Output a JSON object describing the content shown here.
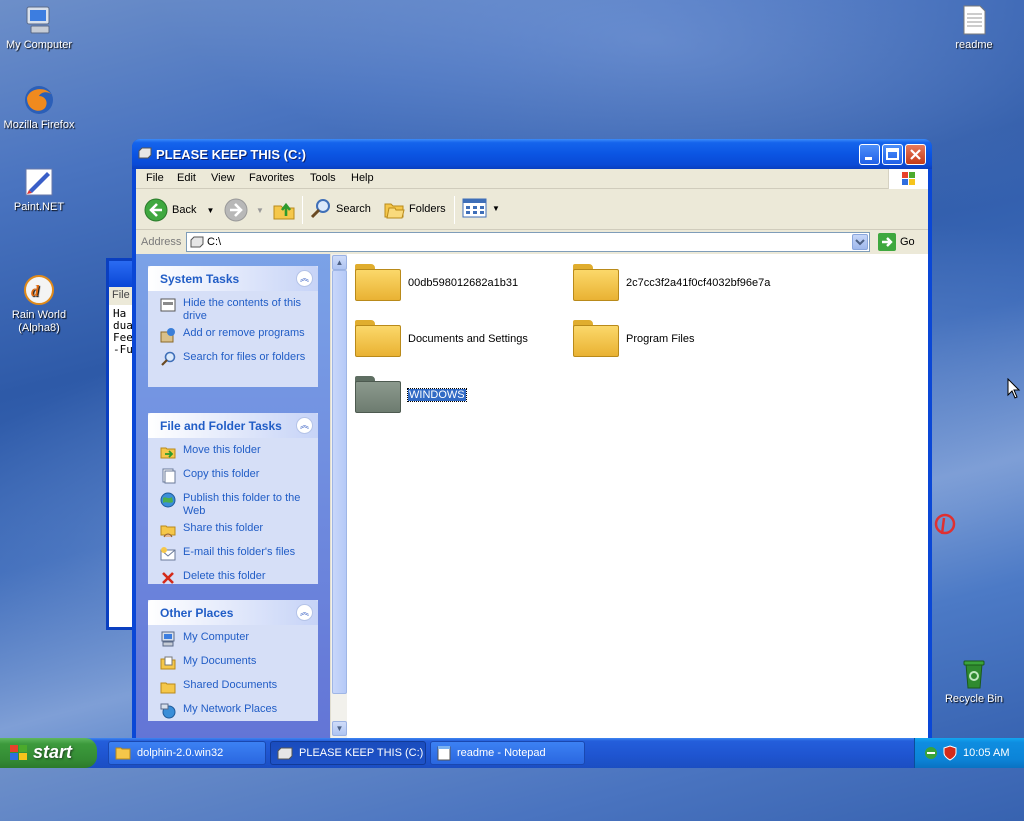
{
  "desktop": {
    "icons": [
      {
        "label": "My Computer"
      },
      {
        "label": "Mozilla Firefox"
      },
      {
        "label": "Paint.NET"
      },
      {
        "label": "Rain World\n(Alpha8)"
      },
      {
        "label": "readme"
      },
      {
        "label": "Recycle Bin"
      }
    ]
  },
  "background_window": {
    "menu_label": "File",
    "text_lines": [
      "Ha",
      "dua",
      "Fee",
      "-Fu"
    ]
  },
  "window": {
    "title": "PLEASE KEEP THIS (C:)",
    "menu": [
      "File",
      "Edit",
      "View",
      "Favorites",
      "Tools",
      "Help"
    ],
    "toolbar": {
      "back": "Back",
      "search": "Search",
      "folders": "Folders"
    },
    "address": {
      "label": "Address",
      "value": "C:\\",
      "go": "Go"
    },
    "task_pane": {
      "system_tasks": {
        "title": "System Tasks",
        "items": [
          "Hide the contents of this drive",
          "Add or remove programs",
          "Search for files or folders"
        ]
      },
      "file_folder_tasks": {
        "title": "File and Folder Tasks",
        "items": [
          "Move this folder",
          "Copy this folder",
          "Publish this folder to the Web",
          "Share this folder",
          "E-mail this folder's files",
          "Delete this folder"
        ]
      },
      "other_places": {
        "title": "Other Places",
        "items": [
          "My Computer",
          "My Documents",
          "Shared Documents",
          "My Network Places"
        ]
      }
    },
    "folders": [
      {
        "name": "00db598012682a1b31"
      },
      {
        "name": "2c7cc3f2a41f0cf4032bf96e7a"
      },
      {
        "name": "Documents and Settings"
      },
      {
        "name": "Program Files"
      },
      {
        "name": "WINDOWS",
        "selected": true
      }
    ]
  },
  "taskbar": {
    "start": "start",
    "tasks": [
      {
        "label": "dolphin-2.0.win32"
      },
      {
        "label": "PLEASE KEEP THIS (C:)",
        "active": true
      },
      {
        "label": "readme - Notepad"
      }
    ],
    "clock": "10:05 AM"
  },
  "colors": {
    "folder_yellow": "#f5c74a",
    "folder_gray": "#7b8a7f",
    "selection_blue": "#316ac5",
    "task_link": "#215dc6"
  }
}
